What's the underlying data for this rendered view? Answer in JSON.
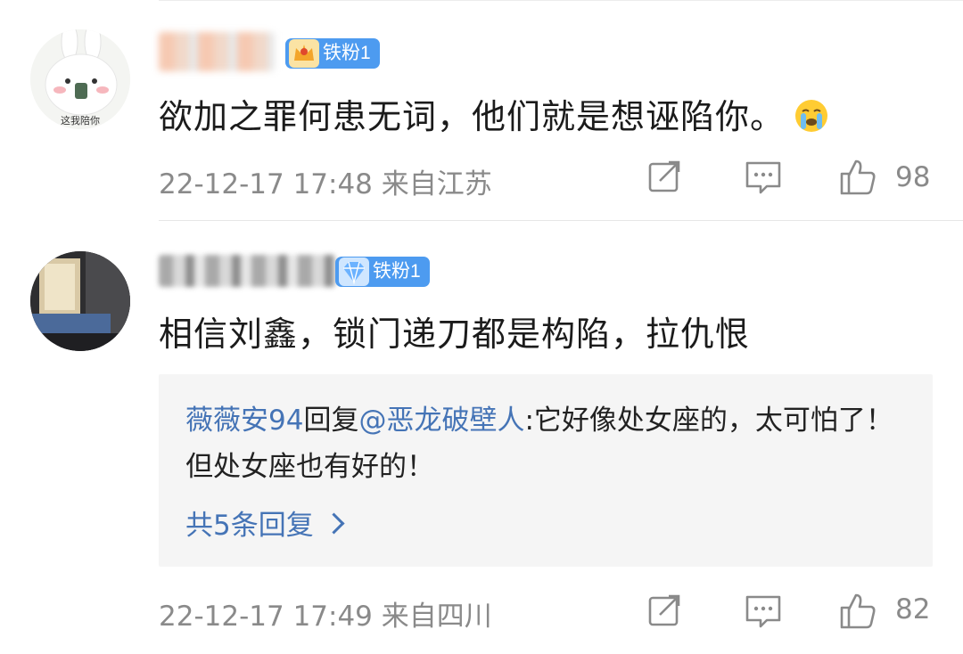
{
  "comments": [
    {
      "badge": "铁粉1",
      "text": "欲加之罪何患无词，他们就是想诬陷你。",
      "emoji": "crying-face-emoji",
      "time": "22-12-17 17:48",
      "location": "来自江苏",
      "likes": "98"
    },
    {
      "badge": "铁粉1",
      "text": "相信刘鑫，锁门递刀都是构陷，拉仇恨",
      "reply": {
        "user": "薇薇安94",
        "verb": "回复",
        "mention": "@恶龙破壁人",
        "text": ":它好像处女座的，太可怕了！但处女座也有好的！",
        "more": "共5条回复"
      },
      "time": "22-12-17 17:49",
      "location": "来自四川",
      "likes": "82"
    }
  ],
  "colors": {
    "badge_bg": "#4d9bf0",
    "link": "#4574b6",
    "meta": "#8a8a8a",
    "reply_bg": "#f5f5f5"
  },
  "icons": [
    "share-icon",
    "comment-icon",
    "thumbs-up-icon"
  ]
}
